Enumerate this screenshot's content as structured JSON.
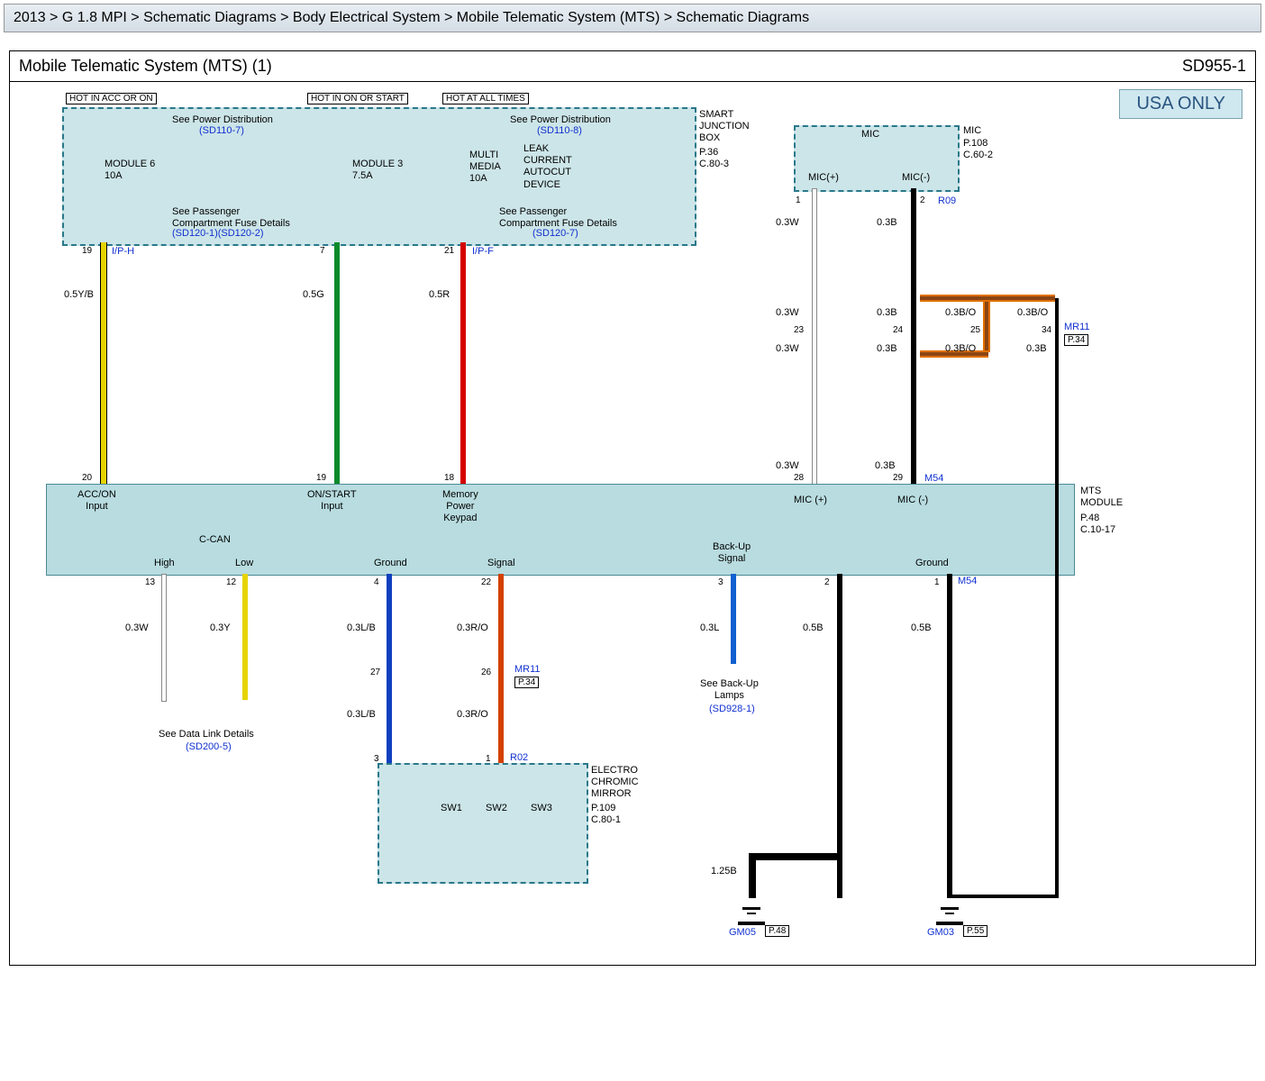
{
  "breadcrumb": "2013 > G 1.8 MPI > Schematic Diagrams > Body Electrical System > Mobile Telematic System (MTS) > Schematic Diagrams",
  "title": "Mobile Telematic System (MTS) (1)",
  "code": "SD955-1",
  "usa": "USA ONLY",
  "hot1": "HOT IN ACC OR ON",
  "hot2": "HOT IN ON OR START",
  "hot3": "HOT AT ALL TIMES",
  "sjb": "SMART\nJUNCTION\nBOX",
  "sjb_ref": "P.36\nC.80-3",
  "pd1": "See Power Distribution",
  "pd1r": "(SD110-7)",
  "pd2": "See Power Distribution",
  "pd2r": "(SD110-8)",
  "mod6": "MODULE 6\n10A",
  "mod3": "MODULE 3\n7.5A",
  "mm": "MULTI\nMEDIA\n10A",
  "leak": "LEAK\nCURRENT\nAUTOCUT\nDEVICE",
  "pass1": "See Passenger\nCompartment Fuse Details",
  "pass1r": "(SD120-1)(SD120-2)",
  "pass2": "See Passenger\nCompartment Fuse Details",
  "pass2r": "(SD120-7)",
  "iph": "I/P-H",
  "ipf": "I/P-F",
  "w_yb": "0.5Y/B",
  "w_g": "0.5G",
  "w_r": "0.5R",
  "mic": "MIC",
  "mic_ref": "P.108\nC.60-2",
  "micp": "MIC(+)",
  "micn": "MIC(-)",
  "r09": "R09",
  "w03w": "0.3W",
  "w03b": "0.3B",
  "w03bo": "0.3B/O",
  "mr11": "MR11",
  "p34": "P.34",
  "m54": "M54",
  "mts_mod": "MTS\nMODULE",
  "mts_ref": "P.48\nC.10-17",
  "in_acc": "ACC/ON\nInput",
  "in_on": "ON/START\nInput",
  "in_mem": "Memory\nPower\nKeypad",
  "in_micp": "MIC (+)",
  "in_micn": "MIC (-)",
  "ccan": "C-CAN",
  "high": "High",
  "low": "Low",
  "ground": "Ground",
  "signal": "Signal",
  "backup": "Back-Up\nSignal",
  "w03y": "0.3Y",
  "w03lb": "0.3L/B",
  "w03ro": "0.3R/O",
  "w03l": "0.3L",
  "w05b": "0.5B",
  "w125b": "1.25B",
  "r02": "R02",
  "dlink": "See Data Link Details",
  "dlinkr": "(SD200-5)",
  "bulamps": "See Back-Up\nLamps",
  "bulampsr": "(SD928-1)",
  "ecm": "ELECTRO\nCHROMIC\nMIRROR",
  "ecm_ref": "P.109\nC.80-1",
  "sw1": "SW1",
  "sw2": "SW2",
  "sw3": "SW3",
  "gm05": "GM05",
  "gm03": "GM03",
  "p48": "P.48",
  "p55": "P.55",
  "pins": {
    "p19": "19",
    "p7": "7",
    "p21": "21",
    "p20": "20",
    "p19b": "19",
    "p18": "18",
    "p1": "1",
    "p2": "2",
    "p3": "3",
    "p4": "4",
    "p12": "12",
    "p13": "13",
    "p22": "22",
    "p23": "23",
    "p24": "24",
    "p25": "25",
    "p26": "26",
    "p27": "27",
    "p28": "28",
    "p29": "29",
    "p34": "34"
  }
}
